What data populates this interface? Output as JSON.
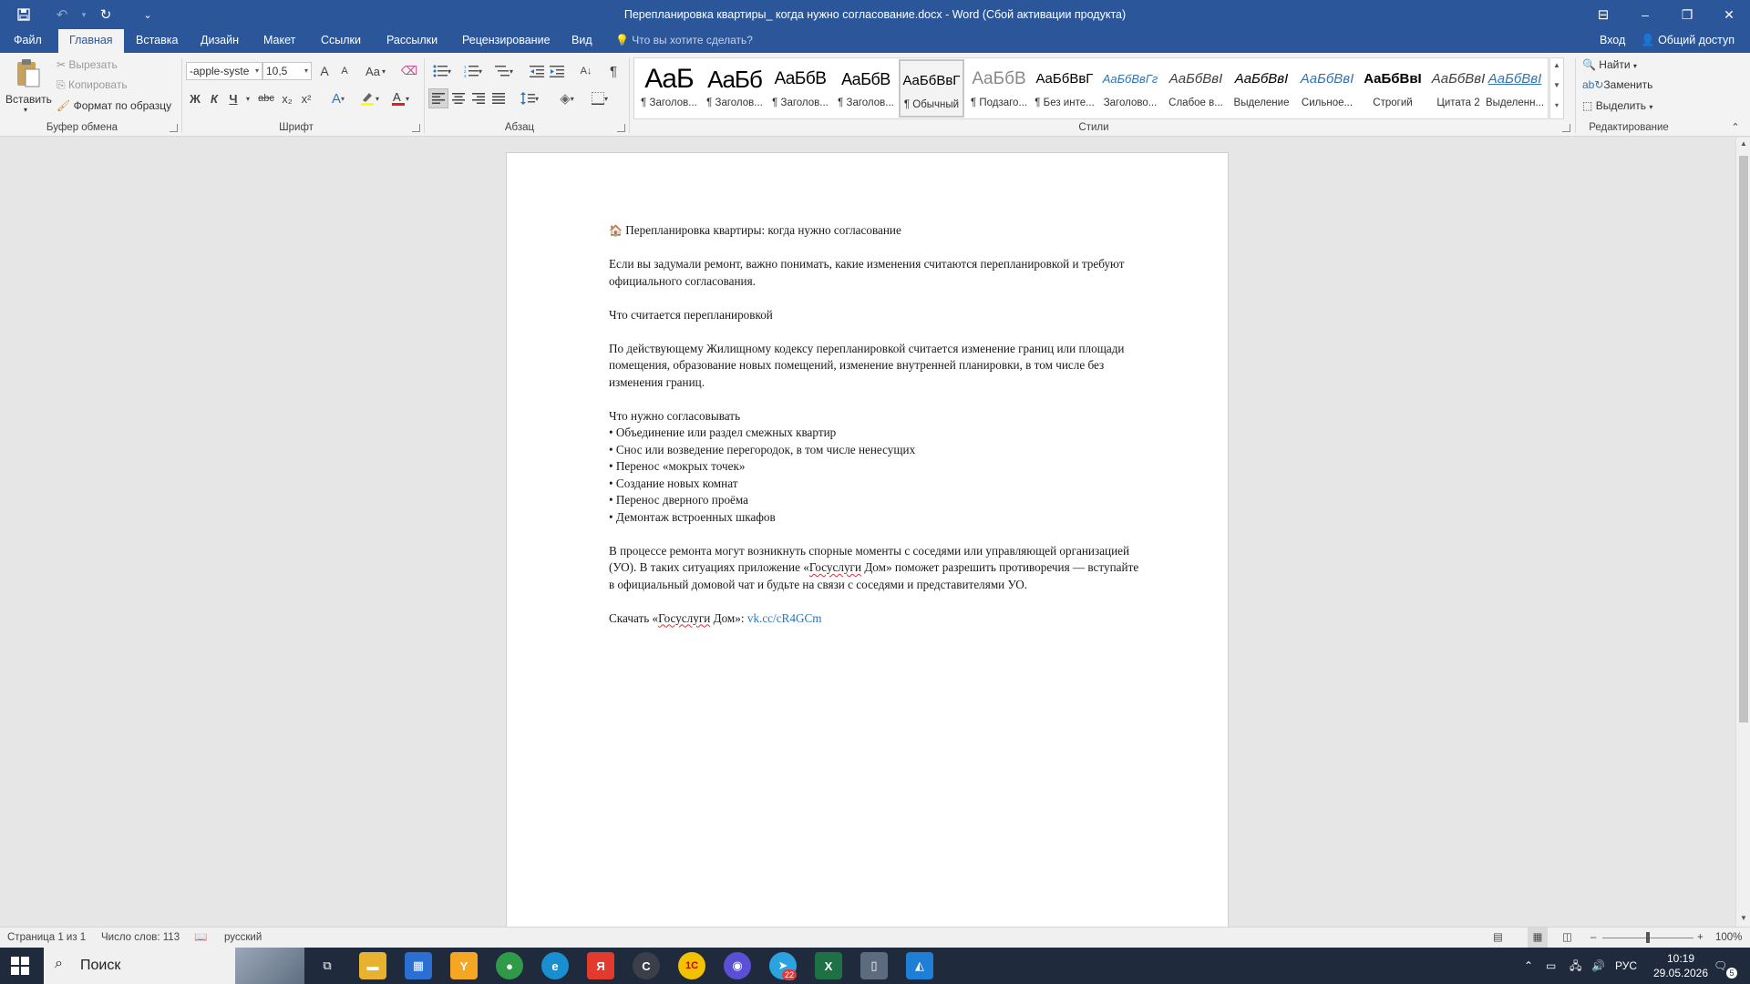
{
  "window": {
    "title": "Перепланировка квартиры_ когда нужно согласование.docx - Word (Сбой активации продукта)",
    "minimize": "–",
    "restore": "❐",
    "close": "✕",
    "ribbon_display": "⊟"
  },
  "qat": {
    "save": "💾",
    "undo": "↶",
    "redo": "↻",
    "customize": "⌄"
  },
  "tabs": [
    "Файл",
    "Главная",
    "Вставка",
    "Дизайн",
    "Макет",
    "Ссылки",
    "Рассылки",
    "Рецензирование",
    "Вид"
  ],
  "tell_me": "Что вы хотите сделать?",
  "sign_in": "Вход",
  "share": "Общий доступ",
  "clipboard": {
    "paste": "Вставить",
    "cut": "Вырезать",
    "copy": "Копировать",
    "format_painter": "Формат по образцу",
    "label": "Буфер обмена"
  },
  "font": {
    "family": "-apple-syste",
    "size": "10,5",
    "bold": "Ж",
    "italic": "К",
    "underline": "Ч",
    "strike": "abc",
    "subscript": "x₂",
    "superscript": "x²",
    "grow": "A",
    "shrink": "A",
    "case": "Aa",
    "label": "Шрифт",
    "highlight_color": "#ffff00",
    "font_color": "#e02020"
  },
  "paragraph": {
    "label": "Абзац",
    "pilcrow": "¶",
    "sort": "А↓"
  },
  "styles": {
    "label": "Стили",
    "items": [
      {
        "preview": "AaБ",
        "name": "¶ Заголов..."
      },
      {
        "preview": "AaБб",
        "name": "¶ Заголов..."
      },
      {
        "preview": "AaБбВ",
        "name": "¶ Заголов..."
      },
      {
        "preview": "AaБбВ",
        "name": "¶ Заголов..."
      },
      {
        "preview": "AaБбВвГ",
        "name": "¶ Обычный"
      },
      {
        "preview": "AaБбВ",
        "name": "¶ Подзаго..."
      },
      {
        "preview": "AaБбВвГ",
        "name": "¶ Без инте..."
      },
      {
        "preview": "AaБбВвГг",
        "name": "Заголово..."
      },
      {
        "preview": "AaБбВвІ",
        "name": "Слабое в..."
      },
      {
        "preview": "AaБбВвІ",
        "name": "Выделение"
      },
      {
        "preview": "AaБбВвІ",
        "name": "Сильное..."
      },
      {
        "preview": "AaБбВвІ",
        "name": "Строгий"
      },
      {
        "preview": "AaБбВвІ",
        "name": "Цитата 2"
      },
      {
        "preview": "AaБбВвІ",
        "name": "Выделенн..."
      }
    ]
  },
  "editing": {
    "find": "Найти",
    "replace": "Заменить",
    "select": "Выделить",
    "label": "Редактирование"
  },
  "document": {
    "title_icon": "🏠",
    "title": "Перепланировка квартиры: когда нужно согласование",
    "intro_1": "Если вы задумали ремонт, важно понимать, какие изменения считаются перепланировкой и требуют",
    "intro_2": "официального согласования.",
    "h1": "Что считается перепланировкой",
    "p1_1": "По действующему Жилищному кодексу перепланировкой считается изменение границ или площади",
    "p1_2": "помещения, образование новых помещений, изменение внутренней планировки, в том числе без",
    "p1_3": "изменения границ.",
    "h2": "Что нужно согласовывать",
    "bullets": [
      "• Объединение или раздел смежных квартир",
      "• Снос или возведение перегородок, в том числе ненесущих",
      "• Перенос «мокрых точек»",
      "• Создание новых комнат",
      "• Перенос дверного проёма",
      "• Демонтаж встроенных шкафов"
    ],
    "p2_1": "В процессе ремонта могут возникнуть спорные моменты с соседями или управляющей организацией",
    "p2_2a": "(УО). В таких ситуациях приложение «",
    "p2_2b": "Госуслуги",
    "p2_2c": " Дом» поможет разрешить противоречия — вступайте",
    "p2_3": "в официальный домовой чат и будьте на связи с соседями и представителями УО.",
    "dl_a": "Скачать «",
    "dl_b": "Госуслуги",
    "dl_c": " Дом»: ",
    "dl_link": "vk.cc/cR4GCm"
  },
  "status": {
    "page": "Страница 1 из 1",
    "words": "Число слов: 113",
    "language": "русский",
    "zoom": "100%",
    "zoom_minus": "–",
    "zoom_plus": "+"
  },
  "taskbar": {
    "search": "Поиск",
    "lang": "РУС",
    "time": "10:19",
    "date": "29.05.2026",
    "notifications": "5",
    "telegram_badge": "22",
    "apps": [
      {
        "name": "task-view",
        "glyph": "⧉",
        "color": "#1f2a3c"
      },
      {
        "name": "file-explorer",
        "glyph": "▬",
        "color": "#e8b130"
      },
      {
        "name": "microsoft-store",
        "glyph": "▦",
        "color": "#2a6fd1"
      },
      {
        "name": "yandex-browser",
        "glyph": "Y",
        "color": "#f5a623"
      },
      {
        "name": "chrome",
        "glyph": "●",
        "color": "#2f9a47"
      },
      {
        "name": "edge",
        "glyph": "e",
        "color": "#1a8fd0"
      },
      {
        "name": "yandex",
        "glyph": "Я",
        "color": "#e23b2e"
      },
      {
        "name": "app-c",
        "glyph": "C",
        "color": "#3a3f4a"
      },
      {
        "name": "1c",
        "glyph": "1С",
        "color": "#f2c100"
      },
      {
        "name": "messenger",
        "glyph": "◉",
        "color": "#5b4fd6"
      },
      {
        "name": "telegram",
        "glyph": "➤",
        "color": "#2aa3e0"
      },
      {
        "name": "excel",
        "glyph": "X",
        "color": "#1e7145"
      },
      {
        "name": "notepad",
        "glyph": "▯",
        "color": "#5d6b80"
      },
      {
        "name": "photos",
        "glyph": "◭",
        "color": "#1f7fd6"
      }
    ]
  }
}
